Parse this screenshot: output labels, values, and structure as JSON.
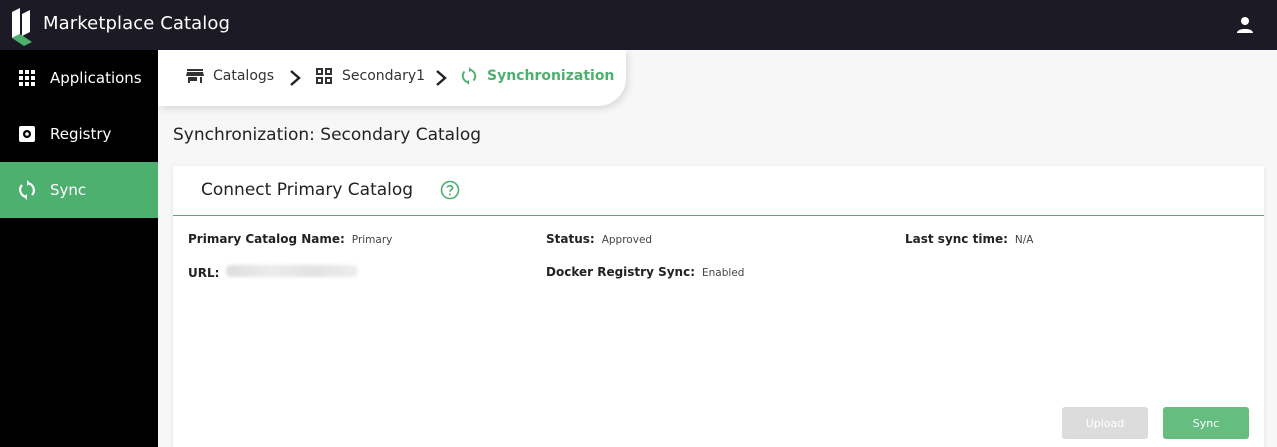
{
  "app": {
    "title": "Marketplace Catalog"
  },
  "sidebar": {
    "items": [
      {
        "label": "Applications",
        "icon": "grid-icon",
        "active": false
      },
      {
        "label": "Registry",
        "icon": "registry-icon",
        "active": false
      },
      {
        "label": "Sync",
        "icon": "sync-icon",
        "active": true
      }
    ]
  },
  "breadcrumb": {
    "items": [
      {
        "label": "Catalogs",
        "icon": "store-icon"
      },
      {
        "label": "Secondary1",
        "icon": "grid-outline-icon"
      },
      {
        "label": "Synchronization",
        "icon": "sync-icon"
      }
    ]
  },
  "page": {
    "title": "Synchronization: Secondary Catalog"
  },
  "card": {
    "title": "Connect Primary Catalog",
    "fields": {
      "primary_name": {
        "label": "Primary Catalog Name:",
        "value": "Primary"
      },
      "url": {
        "label": "URL:",
        "value": ""
      },
      "status": {
        "label": "Status:",
        "value": "Approved"
      },
      "docker_sync": {
        "label": "Docker Registry Sync:",
        "value": "Enabled"
      },
      "last_sync": {
        "label": "Last sync time:",
        "value": "N/A"
      }
    },
    "buttons": {
      "upload": "Upload",
      "sync": "Sync"
    }
  },
  "colors": {
    "accent": "#4db06e",
    "topbar": "#1c1b25",
    "sidebar": "#000000"
  }
}
